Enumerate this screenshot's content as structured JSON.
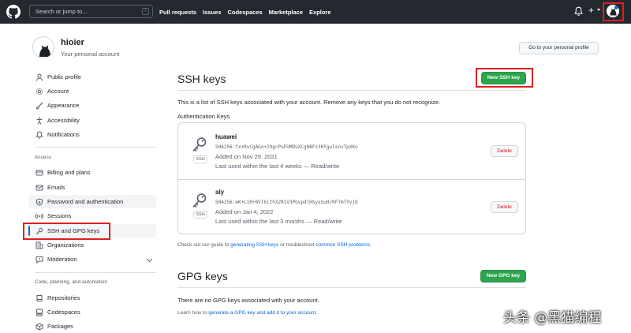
{
  "header": {
    "search_placeholder": "Search or jump to...",
    "search_shortcut": "/",
    "nav": [
      "Pull requests",
      "Issues",
      "Codespaces",
      "Marketplace",
      "Explore"
    ],
    "plus": "+"
  },
  "profile": {
    "name": "hioier",
    "subtitle": "Your personal account",
    "profile_button": "Go to your personal profile"
  },
  "sidebar": {
    "items": [
      {
        "label": "Public profile",
        "icon": "person-icon"
      },
      {
        "label": "Account",
        "icon": "gear-icon"
      },
      {
        "label": "Appearance",
        "icon": "paintbrush-icon"
      },
      {
        "label": "Accessibility",
        "icon": "accessibility-icon"
      },
      {
        "label": "Notifications",
        "icon": "bell-icon"
      }
    ],
    "access_heading": "Access",
    "access_items": [
      {
        "label": "Billing and plans",
        "icon": "credit-card-icon"
      },
      {
        "label": "Emails",
        "icon": "mail-icon"
      },
      {
        "label": "Password and authentication",
        "icon": "shield-lock-icon"
      },
      {
        "label": "Sessions",
        "icon": "broadcast-icon"
      },
      {
        "label": "SSH and GPG keys",
        "icon": "key-icon"
      },
      {
        "label": "Organizations",
        "icon": "organization-icon"
      },
      {
        "label": "Moderation",
        "icon": "report-icon"
      }
    ],
    "code_heading": "Code, planning, and automation",
    "code_items": [
      {
        "label": "Repositories",
        "icon": "repo-icon"
      },
      {
        "label": "Codespaces",
        "icon": "codespaces-icon"
      },
      {
        "label": "Packages",
        "icon": "package-icon"
      }
    ]
  },
  "ssh": {
    "title": "SSH keys",
    "new_button": "New SSH key",
    "description": "This is a list of SSH keys associated with your account. Remove any keys that you do not recognize.",
    "auth_heading": "Authentication Keys",
    "keys": [
      {
        "name": "huawei",
        "fingerprint": "SHA256:tx+RvCgAGo+29gcPuFUMDuXCgHBFz3KFguIsnvTpXKo",
        "added": "Added on Nov 29, 2021",
        "last_used": "Last used within the last 4 weeks — Read/write",
        "tag": "SSH",
        "delete_label": "Delete"
      },
      {
        "name": "aly",
        "fingerprint": "SHA256:eK+L1R+8Vl6ithX2R1V3PGvpdlHSyxSuH/KF7mTYvjQ",
        "added": "Added on Jan 4, 2022",
        "last_used": "Last used within the last 3 months — Read/write",
        "tag": "SSH",
        "delete_label": "Delete"
      }
    ],
    "guide_prefix": "Check out our guide to ",
    "guide_link1": "generating SSH keys",
    "guide_middle": " or troubleshoot ",
    "guide_link2": "common SSH problems",
    "guide_suffix": "."
  },
  "gpg": {
    "title": "GPG keys",
    "new_button": "New GPG key",
    "empty_text": "There are no GPG keys associated with your account.",
    "learn_prefix": "Learn how to ",
    "learn_link": "generate a GPG key and add it to your account",
    "learn_suffix": "."
  },
  "watermark": "头条 @黑猫编程",
  "colors": {
    "header_bg": "#24292f",
    "primary_green": "#2da44e",
    "link_blue": "#0969da",
    "danger_red": "#cf222e",
    "highlight_red": "#e01e1e"
  }
}
